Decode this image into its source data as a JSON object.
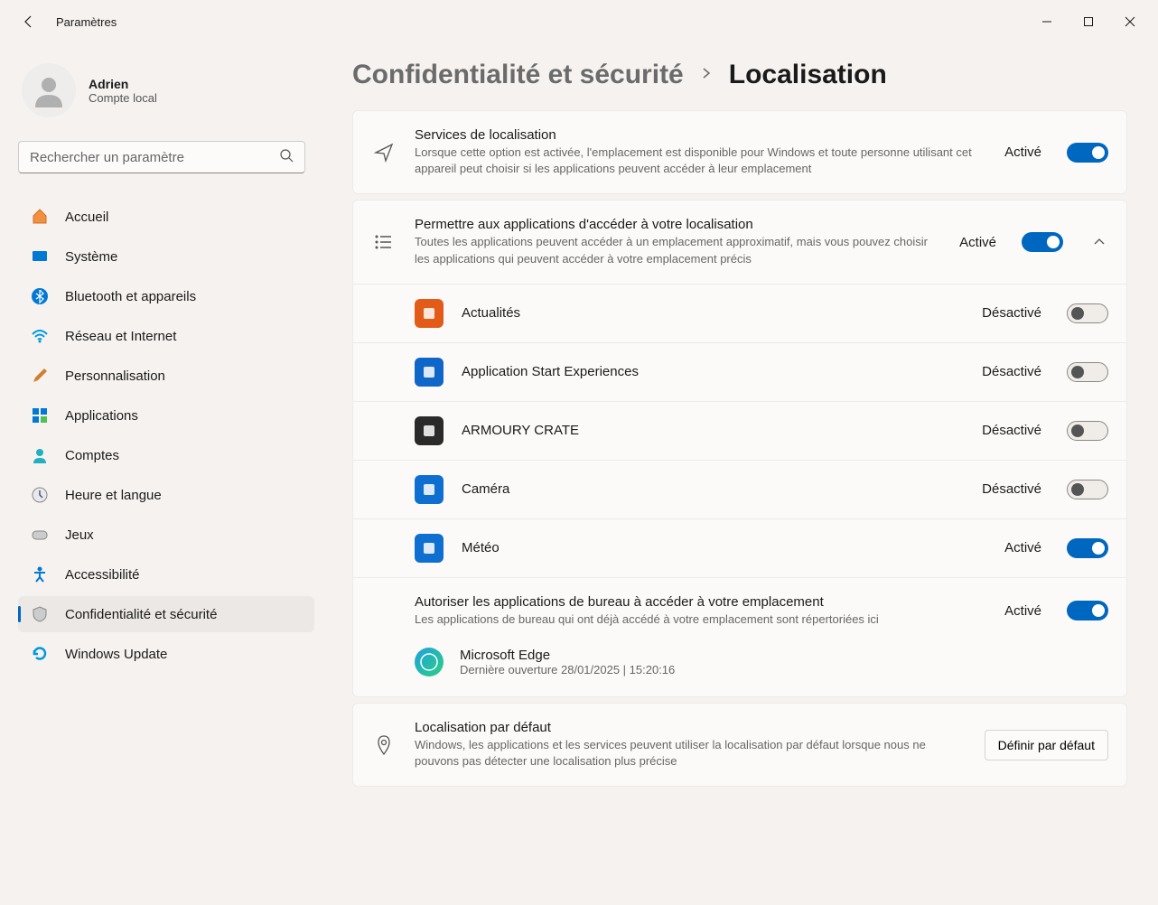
{
  "app": {
    "title": "Paramètres"
  },
  "profile": {
    "name": "Adrien",
    "subtitle": "Compte local"
  },
  "search": {
    "placeholder": "Rechercher un paramètre"
  },
  "sidebar": {
    "items": [
      {
        "label": "Accueil"
      },
      {
        "label": "Système"
      },
      {
        "label": "Bluetooth et appareils"
      },
      {
        "label": "Réseau et Internet"
      },
      {
        "label": "Personnalisation"
      },
      {
        "label": "Applications"
      },
      {
        "label": "Comptes"
      },
      {
        "label": "Heure et langue"
      },
      {
        "label": "Jeux"
      },
      {
        "label": "Accessibilité"
      },
      {
        "label": "Confidentialité et sécurité"
      },
      {
        "label": "Windows Update"
      }
    ]
  },
  "breadcrumb": {
    "parent": "Confidentialité et sécurité",
    "current": "Localisation"
  },
  "locationServices": {
    "title": "Services de localisation",
    "desc": "Lorsque cette option est activée, l'emplacement est disponible pour Windows et toute personne utilisant cet appareil peut choisir si les applications peuvent accéder à leur emplacement",
    "status": "Activé"
  },
  "allowApps": {
    "title": "Permettre aux applications d'accéder à votre localisation",
    "desc": "Toutes les applications peuvent accéder à un emplacement approximatif, mais vous pouvez choisir les applications qui peuvent accéder à votre emplacement précis",
    "status": "Activé"
  },
  "apps": [
    {
      "name": "Actualités",
      "status": "Désactivé",
      "on": false,
      "bg": "#e35b18"
    },
    {
      "name": "Application Start Experiences",
      "status": "Désactivé",
      "on": false,
      "bg": "#1066c8"
    },
    {
      "name": "ARMOURY CRATE",
      "status": "Désactivé",
      "on": false,
      "bg": "#2a2a2a"
    },
    {
      "name": "Caméra",
      "status": "Désactivé",
      "on": false,
      "bg": "#0f6fd0"
    },
    {
      "name": "Météo",
      "status": "Activé",
      "on": true,
      "bg": "#0f6fd0"
    }
  ],
  "desktopApps": {
    "title": "Autoriser les applications de bureau à accéder à votre emplacement",
    "desc": "Les applications de bureau qui ont déjà accédé à votre emplacement sont répertoriées ici",
    "status": "Activé",
    "items": [
      {
        "name": "Microsoft Edge",
        "sub": "Dernière ouverture 28/01/2025  |  15:20:16"
      }
    ]
  },
  "defaultLocation": {
    "title": "Localisation par défaut",
    "desc": "Windows, les applications et les services peuvent utiliser la localisation par défaut lorsque nous ne pouvons pas détecter une localisation plus précise",
    "button": "Définir par défaut"
  }
}
